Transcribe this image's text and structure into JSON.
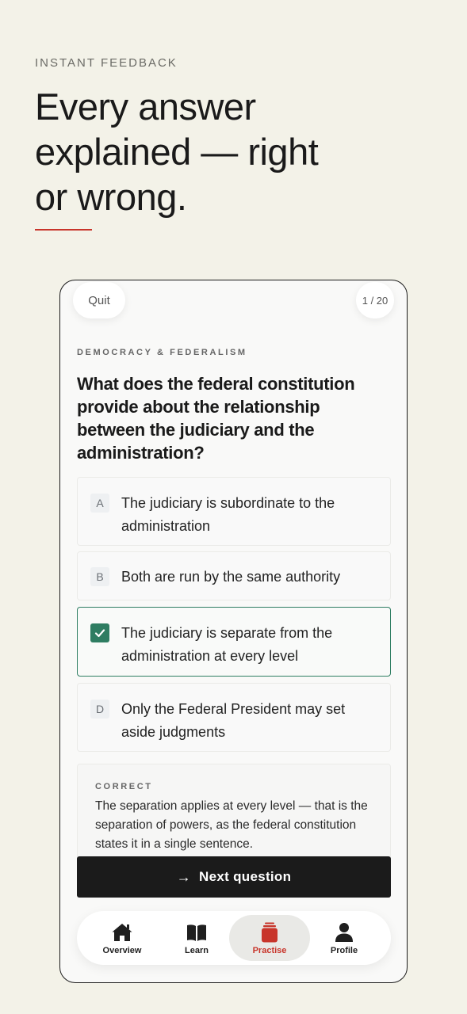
{
  "header": {
    "eyebrow": "INSTANT FEEDBACK",
    "headline_lines": [
      "Every answer",
      "explained — right",
      "or wrong."
    ],
    "accent_color": "#c8352b"
  },
  "quiz": {
    "quit_label": "Quit",
    "counter": "1 / 20",
    "category": "DEMOCRACY & FEDERALISM",
    "question": "What does the federal constitution provide about the relationship between the judiciary and the administration?",
    "options": [
      {
        "letter": "A",
        "text": "The judiciary is subordinate to the administration",
        "state": "default"
      },
      {
        "letter": "B",
        "text": "Both are run by the same authority",
        "state": "default"
      },
      {
        "letter": "C",
        "text": "The judiciary is separate from the administration at every level",
        "state": "correct",
        "icon": "check-icon"
      },
      {
        "letter": "D",
        "text": "Only the Federal President may set aside judgments",
        "state": "default"
      }
    ],
    "feedback": {
      "label": "CORRECT",
      "body": "The separation applies at every level — that is the separation of powers, as the federal constitution states it in a single sentence."
    },
    "next_label": "Next question",
    "next_icon": "arrow-right-icon",
    "correct_color": "#2f7d62"
  },
  "tabbar": {
    "active": "Practise",
    "items": [
      {
        "label": "Overview",
        "icon": "home-icon"
      },
      {
        "label": "Learn",
        "icon": "book-icon"
      },
      {
        "label": "Practise",
        "icon": "cards-icon"
      },
      {
        "label": "Profile",
        "icon": "person-icon"
      }
    ]
  }
}
